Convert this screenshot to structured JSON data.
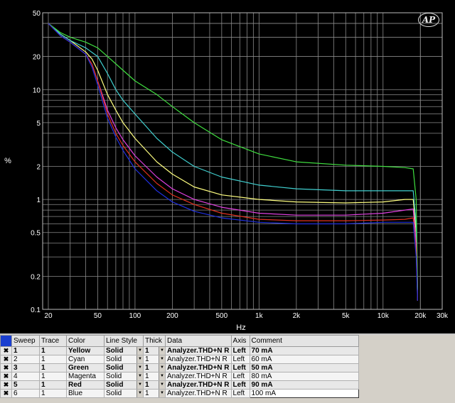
{
  "chart_data": {
    "type": "line",
    "xscale": "log",
    "yscale": "log",
    "xlabel": "Hz",
    "ylabel": "%",
    "xlim": [
      18,
      30000
    ],
    "ylim": [
      0.1,
      50
    ],
    "grid": true,
    "xticks": [
      {
        "v": 20,
        "label": "20"
      },
      {
        "v": 50,
        "label": "50"
      },
      {
        "v": 100,
        "label": "100"
      },
      {
        "v": 200,
        "label": "200"
      },
      {
        "v": 500,
        "label": "500"
      },
      {
        "v": 1000,
        "label": "1k"
      },
      {
        "v": 2000,
        "label": "2k"
      },
      {
        "v": 5000,
        "label": "5k"
      },
      {
        "v": 10000,
        "label": "10k"
      },
      {
        "v": 20000,
        "label": "20k"
      },
      {
        "v": 30000,
        "label": "30k"
      }
    ],
    "yticks": [
      {
        "v": 50,
        "label": "50"
      },
      {
        "v": 20,
        "label": "20"
      },
      {
        "v": 10,
        "label": "10"
      },
      {
        "v": 5,
        "label": "5"
      },
      {
        "v": 2,
        "label": "2"
      },
      {
        "v": 1,
        "label": "1"
      },
      {
        "v": 0.5,
        "label": "0.5"
      },
      {
        "v": 0.2,
        "label": "0.2"
      },
      {
        "v": 0.1,
        "label": "0.1"
      }
    ],
    "series": [
      {
        "name": "70 mA",
        "color": "#ffff80",
        "points": [
          [
            20,
            40
          ],
          [
            25,
            32
          ],
          [
            30,
            28
          ],
          [
            40,
            22
          ],
          [
            45,
            19
          ],
          [
            50,
            15
          ],
          [
            60,
            9
          ],
          [
            70,
            6.5
          ],
          [
            80,
            5
          ],
          [
            100,
            3.6
          ],
          [
            150,
            2.2
          ],
          [
            200,
            1.7
          ],
          [
            300,
            1.3
          ],
          [
            500,
            1.1
          ],
          [
            1000,
            1.0
          ],
          [
            2000,
            0.95
          ],
          [
            5000,
            0.93
          ],
          [
            10000,
            0.95
          ],
          [
            15000,
            1.0
          ],
          [
            17500,
            1.0
          ],
          [
            18500,
            0.5
          ],
          [
            19000,
            0.15
          ]
        ]
      },
      {
        "name": "60 mA",
        "color": "#40d0d0",
        "points": [
          [
            20,
            40
          ],
          [
            25,
            32
          ],
          [
            30,
            28
          ],
          [
            40,
            24
          ],
          [
            50,
            20
          ],
          [
            60,
            14
          ],
          [
            70,
            10
          ],
          [
            80,
            8
          ],
          [
            100,
            6
          ],
          [
            150,
            3.6
          ],
          [
            200,
            2.7
          ],
          [
            300,
            2.0
          ],
          [
            500,
            1.6
          ],
          [
            1000,
            1.35
          ],
          [
            2000,
            1.25
          ],
          [
            5000,
            1.2
          ],
          [
            10000,
            1.2
          ],
          [
            15000,
            1.2
          ],
          [
            17500,
            1.2
          ],
          [
            18500,
            0.6
          ],
          [
            19000,
            0.12
          ]
        ]
      },
      {
        "name": "50 mA",
        "color": "#40e040",
        "points": [
          [
            20,
            40
          ],
          [
            25,
            33
          ],
          [
            30,
            30
          ],
          [
            40,
            27
          ],
          [
            50,
            24
          ],
          [
            60,
            20
          ],
          [
            80,
            15
          ],
          [
            100,
            12
          ],
          [
            150,
            9
          ],
          [
            200,
            7
          ],
          [
            300,
            5
          ],
          [
            500,
            3.5
          ],
          [
            1000,
            2.6
          ],
          [
            2000,
            2.2
          ],
          [
            5000,
            2.05
          ],
          [
            10000,
            2.0
          ],
          [
            15000,
            1.95
          ],
          [
            17500,
            1.9
          ],
          [
            18500,
            1.0
          ],
          [
            19000,
            0.15
          ]
        ]
      },
      {
        "name": "80 mA",
        "color": "#e040e0",
        "points": [
          [
            20,
            40
          ],
          [
            25,
            31
          ],
          [
            30,
            27
          ],
          [
            40,
            21
          ],
          [
            45,
            17
          ],
          [
            50,
            12
          ],
          [
            60,
            6.5
          ],
          [
            70,
            4.5
          ],
          [
            80,
            3.5
          ],
          [
            100,
            2.5
          ],
          [
            150,
            1.6
          ],
          [
            200,
            1.25
          ],
          [
            300,
            1.0
          ],
          [
            500,
            0.85
          ],
          [
            1000,
            0.75
          ],
          [
            2000,
            0.72
          ],
          [
            5000,
            0.72
          ],
          [
            10000,
            0.75
          ],
          [
            15000,
            0.8
          ],
          [
            17500,
            0.82
          ],
          [
            18500,
            0.4
          ],
          [
            19000,
            0.12
          ]
        ]
      },
      {
        "name": "90 mA",
        "color": "#e03020",
        "points": [
          [
            20,
            40
          ],
          [
            25,
            31
          ],
          [
            30,
            27
          ],
          [
            40,
            21
          ],
          [
            45,
            17
          ],
          [
            50,
            12
          ],
          [
            60,
            6
          ],
          [
            70,
            4
          ],
          [
            80,
            3.1
          ],
          [
            100,
            2.2
          ],
          [
            150,
            1.4
          ],
          [
            200,
            1.1
          ],
          [
            300,
            0.9
          ],
          [
            500,
            0.75
          ],
          [
            1000,
            0.66
          ],
          [
            2000,
            0.64
          ],
          [
            5000,
            0.64
          ],
          [
            10000,
            0.65
          ],
          [
            15000,
            0.66
          ],
          [
            17500,
            0.68
          ],
          [
            18500,
            0.35
          ],
          [
            19000,
            0.12
          ]
        ]
      },
      {
        "name": "100 mA",
        "color": "#2030e0",
        "points": [
          [
            20,
            40
          ],
          [
            25,
            31
          ],
          [
            30,
            27
          ],
          [
            40,
            21
          ],
          [
            45,
            16
          ],
          [
            50,
            11
          ],
          [
            60,
            5.5
          ],
          [
            70,
            3.7
          ],
          [
            80,
            2.8
          ],
          [
            100,
            1.9
          ],
          [
            150,
            1.2
          ],
          [
            200,
            0.95
          ],
          [
            300,
            0.78
          ],
          [
            500,
            0.68
          ],
          [
            1000,
            0.62
          ],
          [
            2000,
            0.6
          ],
          [
            5000,
            0.6
          ],
          [
            10000,
            0.62
          ],
          [
            15000,
            0.62
          ],
          [
            17500,
            0.62
          ],
          [
            18500,
            0.3
          ],
          [
            19000,
            0.12
          ]
        ]
      }
    ]
  },
  "table": {
    "headers": {
      "sweep": "Sweep",
      "trace": "Trace",
      "color": "Color",
      "linestyle": "Line Style",
      "thick": "Thick",
      "data": "Data",
      "axis": "Axis",
      "comment": "Comment"
    },
    "rows": [
      {
        "sweep": "1",
        "trace": "1",
        "color": "Yellow",
        "linestyle": "Solid",
        "thick": "1",
        "data": "Analyzer.THD+N R",
        "axis": "Left",
        "comment": "70 mA",
        "bold": true
      },
      {
        "sweep": "2",
        "trace": "1",
        "color": "Cyan",
        "linestyle": "Solid",
        "thick": "1",
        "data": "Analyzer.THD+N R",
        "axis": "Left",
        "comment": "60 mA",
        "bold": false
      },
      {
        "sweep": "3",
        "trace": "1",
        "color": "Green",
        "linestyle": "Solid",
        "thick": "1",
        "data": "Analyzer.THD+N R",
        "axis": "Left",
        "comment": "50 mA",
        "bold": true
      },
      {
        "sweep": "4",
        "trace": "1",
        "color": "Magenta",
        "linestyle": "Solid",
        "thick": "1",
        "data": "Analyzer.THD+N R",
        "axis": "Left",
        "comment": "80 mA",
        "bold": false
      },
      {
        "sweep": "5",
        "trace": "1",
        "color": "Red",
        "linestyle": "Solid",
        "thick": "1",
        "data": "Analyzer.THD+N R",
        "axis": "Left",
        "comment": "90 mA",
        "bold": true
      },
      {
        "sweep": "6",
        "trace": "1",
        "color": "Blue",
        "linestyle": "Solid",
        "thick": "1",
        "data": "Analyzer.THD+N R",
        "axis": "Left",
        "comment": "100 mA",
        "bold": false
      }
    ]
  },
  "logo": {
    "text": "AP"
  }
}
